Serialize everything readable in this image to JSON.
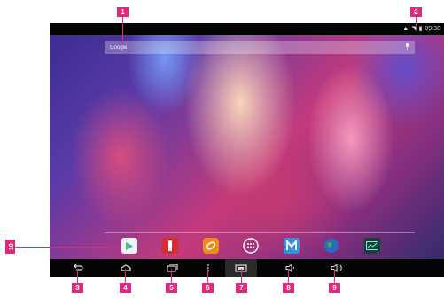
{
  "search": {
    "placeholder": "Google"
  },
  "status_bar": {
    "time": "09:38"
  },
  "dock": {
    "apps": [
      {
        "name": "Play Store"
      },
      {
        "name": "Flashlight"
      },
      {
        "name": "Browser"
      },
      {
        "name": "All Apps"
      },
      {
        "name": "Gmail"
      },
      {
        "name": "Globe"
      },
      {
        "name": "Screen"
      }
    ]
  },
  "callouts": [
    "1",
    "2",
    "3",
    "4",
    "5",
    "6",
    "7",
    "8",
    "9",
    "10"
  ],
  "colors": {
    "callout": "#e0287c",
    "bar": "#050505"
  }
}
